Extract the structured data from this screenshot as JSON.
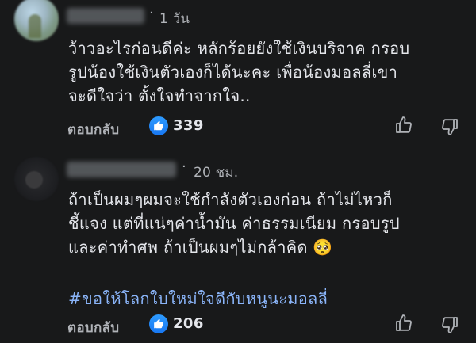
{
  "comments": [
    {
      "time": "1 วัน",
      "text": "ว้าวอะไรก่อนดีค่ะ หลักร้อยยังใช้เงินบริจาค กรอบ\nรูปน้องใช้เงินตัวเองก็ได้นะคะ เพื่อน้องมอลลี่เขา\nจะดีใจว่า ตั้งใจทำจากใจ..",
      "reply_label": "ตอบกลับ",
      "like_count": "339"
    },
    {
      "time": "20 ชม.",
      "text": "ถ้าเป็นผมๆผมจะใช้กำลังตัวเองก่อน ถ้าไม่ไหวก็\nชี้แจง แต่ที่แน่ๆค่าน้ำมัน ค่าธรรมเนียม กรอบรูป\nและค่าทำศพ ถ้าเป็นผมๆไม่กล้าคิด 🥺",
      "hashtag": "#ขอให้โลกใบใหม่ใจดีกับหนูนะมอลลี่",
      "reply_label": "ตอบกลับ",
      "like_count": "206"
    }
  ],
  "icons": {
    "like_badge": "thumbs-up-icon",
    "like_action": "thumbs-up-outline-icon",
    "dislike_action": "thumbs-down-outline-icon"
  },
  "colors": {
    "background": "#18191a",
    "text": "#e4e6eb",
    "secondary": "#b0b3b8",
    "hashtag": "#8ab4f8",
    "like_blue": "#1877f2"
  }
}
